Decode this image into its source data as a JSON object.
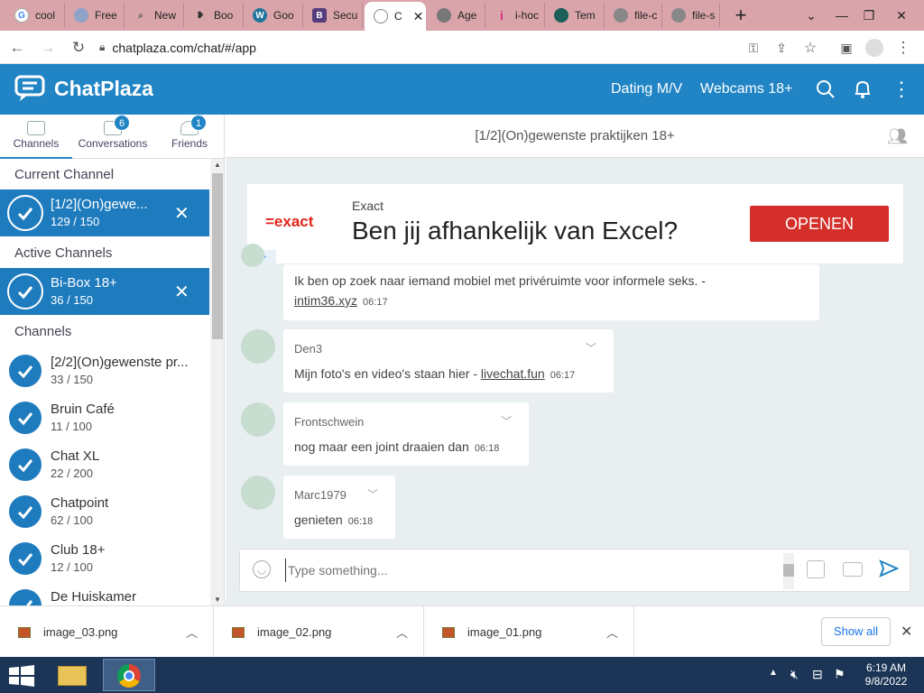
{
  "browser": {
    "tabs": [
      {
        "label": "cool",
        "icon": "google-icon"
      },
      {
        "label": "Free",
        "icon": "web-icon"
      },
      {
        "label": "New",
        "icon": "search-icon"
      },
      {
        "label": "Boo",
        "icon": "book-icon"
      },
      {
        "label": "Goo",
        "icon": "wordpress-icon"
      },
      {
        "label": "Secu",
        "icon": "b-icon"
      },
      {
        "label": "C",
        "icon": "chat-icon",
        "active": true
      },
      {
        "label": "Age",
        "icon": "globe-icon"
      },
      {
        "label": "i-hoc",
        "icon": "i-icon"
      },
      {
        "label": "Tem",
        "icon": "template-icon"
      },
      {
        "label": "file-c",
        "icon": "globe-icon"
      },
      {
        "label": "file-s",
        "icon": "globe-icon"
      }
    ],
    "url": "chatplaza.com/chat/#/app"
  },
  "app": {
    "logo": "ChatPlaza",
    "header_links": [
      "Dating M/V",
      "Webcams 18+"
    ]
  },
  "sidebar": {
    "tabs": [
      {
        "label": "Channels"
      },
      {
        "label": "Conversations",
        "badge": "6"
      },
      {
        "label": "Friends",
        "badge": "1"
      }
    ],
    "current_header": "Current Channel",
    "active_header": "Active Channels",
    "channels_header": "Channels",
    "current": [
      {
        "name": "[1/2](On)gewe...",
        "count": "129 / 150"
      }
    ],
    "active": [
      {
        "name": "Bi-Box 18+",
        "count": "36 / 150"
      }
    ],
    "channels": [
      {
        "name": "[2/2](On)gewenste pr...",
        "count": "33 / 150"
      },
      {
        "name": "Bruin Café",
        "count": "11 / 100"
      },
      {
        "name": "Chat XL",
        "count": "22 / 200"
      },
      {
        "name": "Chatpoint",
        "count": "62 / 100"
      },
      {
        "name": "Club 18+",
        "count": "12 / 100"
      },
      {
        "name": "De Huiskamer",
        "count": ""
      }
    ]
  },
  "main": {
    "title": "[1/2](On)gewenste praktijken 18+",
    "ad": {
      "brand_logo": "=exact",
      "brand": "Exact",
      "headline": "Ben jij afhankelijk van Excel?",
      "cta": "OPENEN"
    },
    "messages": [
      {
        "name": "",
        "text": "Ik ben op zoek naar iemand mobiel met privéruimte voor informele seks. -",
        "text2": "intim36.xyz",
        "time": "06:17"
      },
      {
        "name": "Den3",
        "text": "Mijn foto's en video's staan hier - ",
        "link": "livechat.fun",
        "time": "06:17"
      },
      {
        "name": "Frontschwein",
        "text": "nog maar een joint draaien dan",
        "time": "06:18"
      },
      {
        "name": "Marc1979",
        "text": "genieten",
        "time": "06:18"
      }
    ],
    "compose_placeholder": "Type something..."
  },
  "downloads": {
    "items": [
      "image_03.png",
      "image_02.png",
      "image_01.png"
    ],
    "show_all": "Show all"
  },
  "taskbar": {
    "time": "6:19 AM",
    "date": "9/8/2022"
  },
  "colors": {
    "brand": "#2185c5",
    "tabbar": "#d9a5ab",
    "selected_channel": "#1e7bbe",
    "ad_button": "#d42f2a"
  }
}
